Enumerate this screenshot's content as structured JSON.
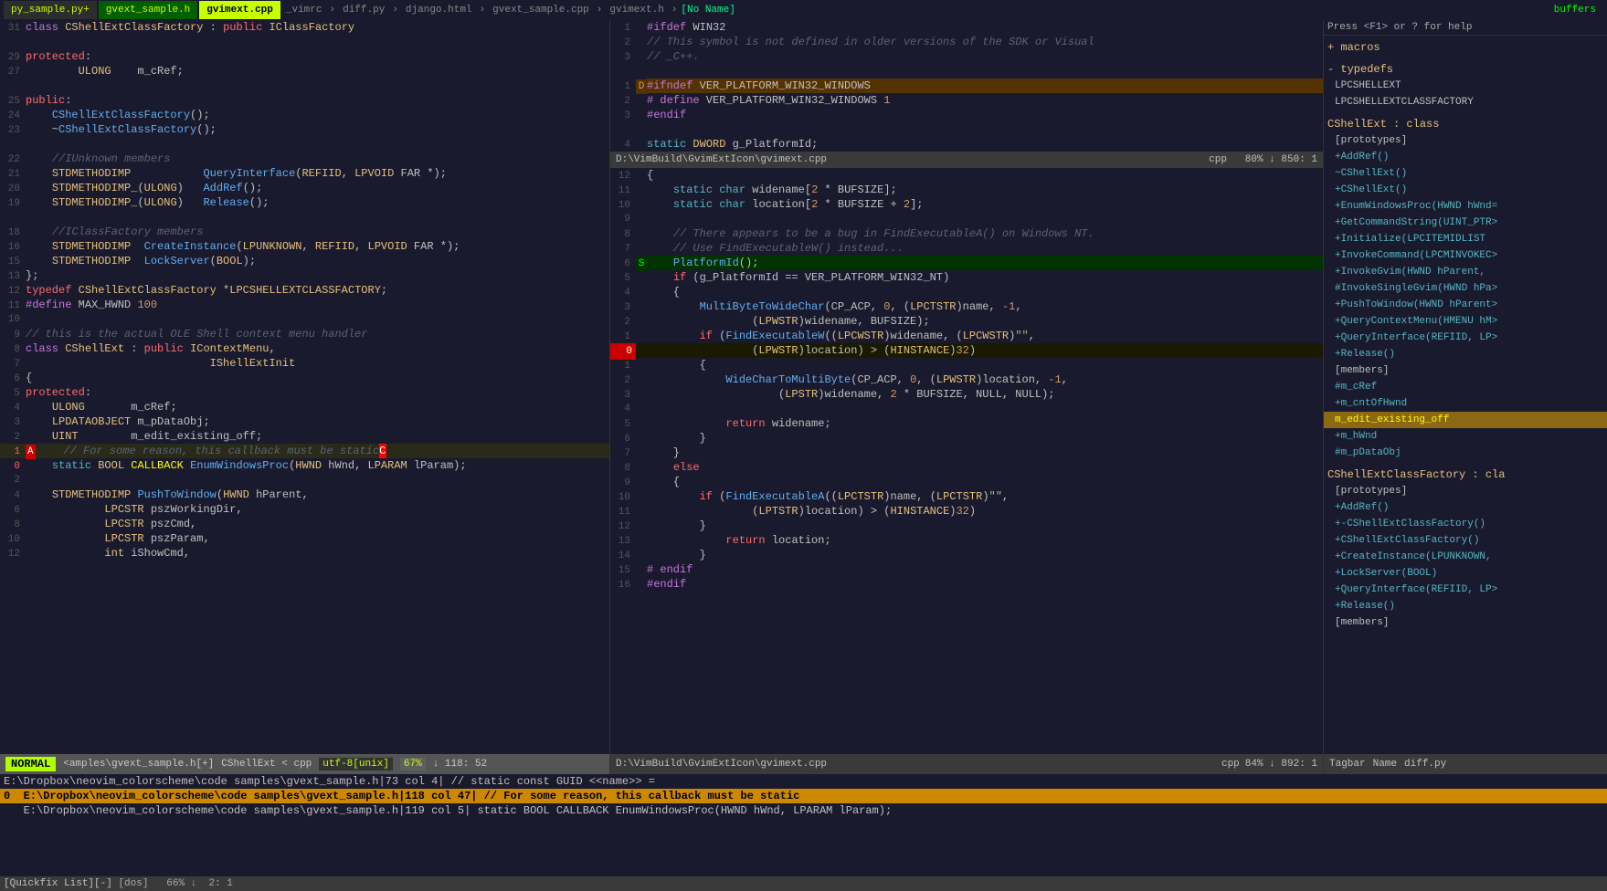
{
  "tabs": [
    {
      "label": "py_sample.py+",
      "style": "tab-py"
    },
    {
      "label": "gvext_sample.h",
      "style": "tab-h"
    },
    {
      "label": "gvimext.cpp",
      "style": "tab-cpp-active"
    }
  ],
  "breadcrumb": {
    "items": [
      "_vimrc",
      "diff.py",
      "django.html",
      "gvext_sample.cpp",
      "gvimext.h"
    ],
    "current": "[No Name]"
  },
  "right_label": "buffers",
  "left_code": [
    {
      "num": "31",
      "content": "class CShellExtClassFactory : public IClassFactory"
    },
    {
      "num": "",
      "content": ""
    },
    {
      "num": "29",
      "content": "protected:"
    },
    {
      "num": "27",
      "content": "        ULONG    m_cRef;"
    },
    {
      "num": "",
      "content": ""
    },
    {
      "num": "25",
      "content": "public:"
    },
    {
      "num": "24",
      "content": "    CShellExtClassFactory();"
    },
    {
      "num": "23",
      "content": "    ~CShellExtClassFactory();"
    },
    {
      "num": "",
      "content": ""
    },
    {
      "num": "22",
      "content": "    //IUnknown members"
    },
    {
      "num": "21",
      "content": "    STDMETHODIMP           QueryInterface(REFIID, LPVOID FAR *);"
    },
    {
      "num": "20",
      "content": "    STDMETHODIMP_(ULONG)   AddRef();"
    },
    {
      "num": "19",
      "content": "    STDMETHODIMP_(ULONG)   Release();"
    },
    {
      "num": "",
      "content": ""
    },
    {
      "num": "18",
      "content": "    //IClassFactory members"
    },
    {
      "num": "16",
      "content": "    STDMETHODIMP  CreateInstance(LPUNKNOWN, REFIID, LPVOID FAR *);"
    },
    {
      "num": "15",
      "content": "    STDMETHODIMP  LockServer(BOOL);"
    },
    {
      "num": "13",
      "content": "};"
    },
    {
      "num": "12",
      "content": "typedef CShellExtClassFactory *LPCSHELLEXTCLASSFACTORY;"
    },
    {
      "num": "11",
      "content": "#define MAX_HWND 100"
    },
    {
      "num": "10",
      "content": ""
    },
    {
      "num": "9",
      "content": "// this is the actual OLE Shell context menu handler"
    },
    {
      "num": "8",
      "content": "class CShellExt : public IContextMenu,"
    },
    {
      "num": "7",
      "content": "                            IShellExtInit"
    },
    {
      "num": "6",
      "content": "{"
    },
    {
      "num": "5",
      "content": "protected:"
    },
    {
      "num": "4",
      "content": "    ULONG       m_cRef;"
    },
    {
      "num": "3",
      "content": "    LPDATAOBJECT m_pDataObj;"
    },
    {
      "num": "2",
      "content": "    UINT        m_edit_existing_off;"
    },
    {
      "num": "1",
      "content": "    // For some reason, this callback must be static"
    },
    {
      "num": "0",
      "content": "    static BOOL CALLBACK EnumWindowsProc(HWND hWnd, LPARAM lParam);"
    },
    {
      "num": "2",
      "content": ""
    },
    {
      "num": "4",
      "content": "    STDMETHODIMP PushToWindow(HWND hParent,"
    },
    {
      "num": "6",
      "content": "            LPCSTR pszWorkingDir,"
    },
    {
      "num": "8",
      "content": "            LPCSTR pszCmd,"
    },
    {
      "num": "10",
      "content": "            LPCSTR pszParam,"
    },
    {
      "num": "12",
      "content": "            int iShowCmd,"
    }
  ],
  "middle_code": [
    {
      "num": "1",
      "diff": "",
      "content": "#ifdef WIN32"
    },
    {
      "num": "2",
      "diff": "",
      "content": "// This symbol is not defined in older versions of the SDK or Visual"
    },
    {
      "num": "3",
      "diff": "",
      "content": "// _C++."
    },
    {
      "num": "",
      "diff": "",
      "content": ""
    },
    {
      "num": "1",
      "diff": "D",
      "content": "#ifndef VER_PLATFORM_WIN32_WINDOWS"
    },
    {
      "num": "2",
      "diff": "",
      "content": "# define VER_PLATFORM_WIN32_WINDOWS 1"
    },
    {
      "num": "3",
      "diff": "",
      "content": "#endif"
    },
    {
      "num": "",
      "diff": "",
      "content": ""
    },
    {
      "num": "4",
      "diff": "",
      "content": "static DWORD g_PlatformId;"
    },
    {
      "num": "",
      "diff": "",
      "content": "D:\\VimBuild\\GvimExtIcon\\gvimext.cpp"
    },
    {
      "num": "12",
      "diff": "",
      "content": "{"
    },
    {
      "num": "11",
      "diff": "",
      "content": "    static char widename[2 * BUFSIZE];"
    },
    {
      "num": "10",
      "diff": "",
      "content": "    static char location[2 * BUFSIZE + 2];"
    },
    {
      "num": "9",
      "diff": "",
      "content": ""
    },
    {
      "num": "8",
      "diff": "",
      "content": "    // There appears to be a bug in FindExecutableA() on Windows NT."
    },
    {
      "num": "7",
      "diff": "",
      "content": "    // Use FindExecutableW() instead..."
    },
    {
      "num": "6",
      "diff": "S",
      "content": "    PlatformId();"
    },
    {
      "num": "5",
      "diff": "",
      "content": "    if (g_PlatformId == VER_PLATFORM_WIN32_NT)"
    },
    {
      "num": "4",
      "diff": "",
      "content": "    {"
    },
    {
      "num": "3",
      "diff": "",
      "content": "        MultiByteToWideChar(CP_ACP, 0, (LPCTSTR)name, -1,"
    },
    {
      "num": "2",
      "diff": "",
      "content": "                (LPWSTR)widename, BUFSIZE);"
    },
    {
      "num": "1",
      "diff": "",
      "content": "        if (FindExecutableW((LPCWSTR)widename, (LPCWSTR)\"\","
    },
    {
      "num": "0",
      "diff": "0",
      "content": "                (LPWSTR)location) > (HINSTANCE)32)"
    },
    {
      "num": "1",
      "diff": "",
      "content": "        {"
    },
    {
      "num": "2",
      "diff": "",
      "content": "            WideCharToMultiByte(CP_ACP, 0, (LPWSTR)location, -1,"
    },
    {
      "num": "3",
      "diff": "",
      "content": "                    (LPSTR)widename, 2 * BUFSIZE, NULL, NULL);"
    },
    {
      "num": "4",
      "diff": "",
      "content": ""
    },
    {
      "num": "5",
      "diff": "",
      "content": "            return widename;"
    },
    {
      "num": "6",
      "diff": "",
      "content": "        }"
    },
    {
      "num": "7",
      "diff": "",
      "content": "    }"
    },
    {
      "num": "8",
      "diff": "",
      "content": "    else"
    },
    {
      "num": "9",
      "diff": "",
      "content": "    {"
    },
    {
      "num": "10",
      "diff": "",
      "content": "        if (FindExecutableA((LPCTSTR)name, (LPCTSTR)\"\","
    },
    {
      "num": "11",
      "diff": "",
      "content": "                (LPTSTR)location) > (HINSTANCE)32)"
    },
    {
      "num": "12",
      "diff": "",
      "content": "        }"
    },
    {
      "num": "13",
      "diff": "",
      "content": "            return location;"
    },
    {
      "num": "14",
      "diff": "",
      "content": "        }"
    },
    {
      "num": "15",
      "diff": "",
      "content": "# endif"
    },
    {
      "num": "16",
      "diff": "",
      "content": "#endif"
    }
  ],
  "right_panel": {
    "header": "Press <F1> or ? for help",
    "sections": [
      {
        "label": "+ macros",
        "items": []
      },
      {
        "label": "- typedefs",
        "items": [
          {
            "text": "LPCSHELLEXT",
            "style": "normal"
          },
          {
            "text": "LPCSHELLEXTCLASSFACTORY",
            "style": "normal"
          }
        ]
      },
      {
        "label": "CShellExt : class",
        "items": [
          {
            "text": "[prototypes]",
            "style": "normal"
          },
          {
            "text": "+AddRef()",
            "style": "cyan"
          },
          {
            "text": "~CShellExt()",
            "style": "cyan"
          },
          {
            "text": "+CShellExt()",
            "style": "cyan"
          },
          {
            "text": "+EnumWindowsProc(HWND hWnd=",
            "style": "cyan"
          },
          {
            "text": "+GetCommandString(UINT_PTR>",
            "style": "cyan"
          },
          {
            "text": "+Initialize(LPCITEMIDLIST",
            "style": "cyan"
          },
          {
            "text": "+InvokeCommand(LPCMINVOKEC>",
            "style": "cyan"
          },
          {
            "text": "+InvokeGvim(HWND hParent,",
            "style": "cyan"
          },
          {
            "text": "#InvokeSingleGvim(HWND hPa>",
            "style": "cyan"
          },
          {
            "text": "+PushToWindow(HWND hParent>",
            "style": "cyan"
          },
          {
            "text": "+QueryContextMenu(HMENU hM>",
            "style": "cyan"
          },
          {
            "text": "+QueryInterface(REFIID, LP>",
            "style": "cyan"
          },
          {
            "text": "+Release()",
            "style": "cyan"
          },
          {
            "text": "[members]",
            "style": "normal"
          },
          {
            "text": "#m_cRef",
            "style": "cyan"
          },
          {
            "text": "+m_cntOfHwnd",
            "style": "cyan"
          },
          {
            "text": "m_edit_existing_off",
            "style": "selected"
          },
          {
            "text": "+m_hWnd",
            "style": "cyan"
          },
          {
            "text": "#m_pDataObj",
            "style": "cyan"
          }
        ]
      },
      {
        "label": "CShellExtClassFactory : cla",
        "items": [
          {
            "text": "[prototypes]",
            "style": "normal"
          },
          {
            "text": "+AddRef()",
            "style": "cyan"
          },
          {
            "text": "+-CShellExtClassFactory()",
            "style": "cyan"
          },
          {
            "text": "+CShellExtClassFactory()",
            "style": "cyan"
          },
          {
            "text": "+CreateInstance(LPUNKNOWN,",
            "style": "cyan"
          },
          {
            "text": "+LockServer(BOOL)",
            "style": "cyan"
          },
          {
            "text": "+QueryInterface(REFIID, LP>",
            "style": "cyan"
          },
          {
            "text": "+Release()",
            "style": "cyan"
          },
          {
            "text": "[members]",
            "style": "normal"
          }
        ]
      }
    ]
  },
  "status_left": {
    "mode": "NORMAL",
    "file": "<amples\\gvext_sample.h[+]",
    "class": "CShellExt < cpp",
    "enc": "utf-8[unix]",
    "pct": "67%",
    "pos": "118: 52"
  },
  "status_middle": {
    "file": "D:\\VimBuild\\GvimExtIcon\\gvimext.cpp",
    "type": "cpp",
    "pct": "84%",
    "pos": "892: 1"
  },
  "tagbar_status": {
    "label": "Tagbar",
    "name_label": "Name",
    "file": "diff.py"
  },
  "messages": [
    {
      "text": "E:\\Dropbox\\neovim_colorscheme\\code samples\\gvext_sample.h|73 col 4| // static const GUID <<name>> =",
      "style": "normal"
    },
    {
      "text": "0  E:\\Dropbox\\neovim_colorscheme\\code samples\\gvext_sample.h|118 col 47| // For some reason, this callback must be static",
      "style": "highlighted"
    },
    {
      "text": "   E:\\Dropbox\\neovim_colorscheme\\code samples\\gvext_sample.h|119 col 5| static BOOL CALLBACK EnumWindowsProc(HWND hWnd, LPARAM lParam);",
      "style": "normal"
    }
  ],
  "quickfix": "[Quickfix List][-]",
  "bottom_status": {
    "dos": "[dos]",
    "pct": "66%",
    "pos": "2: 1"
  }
}
